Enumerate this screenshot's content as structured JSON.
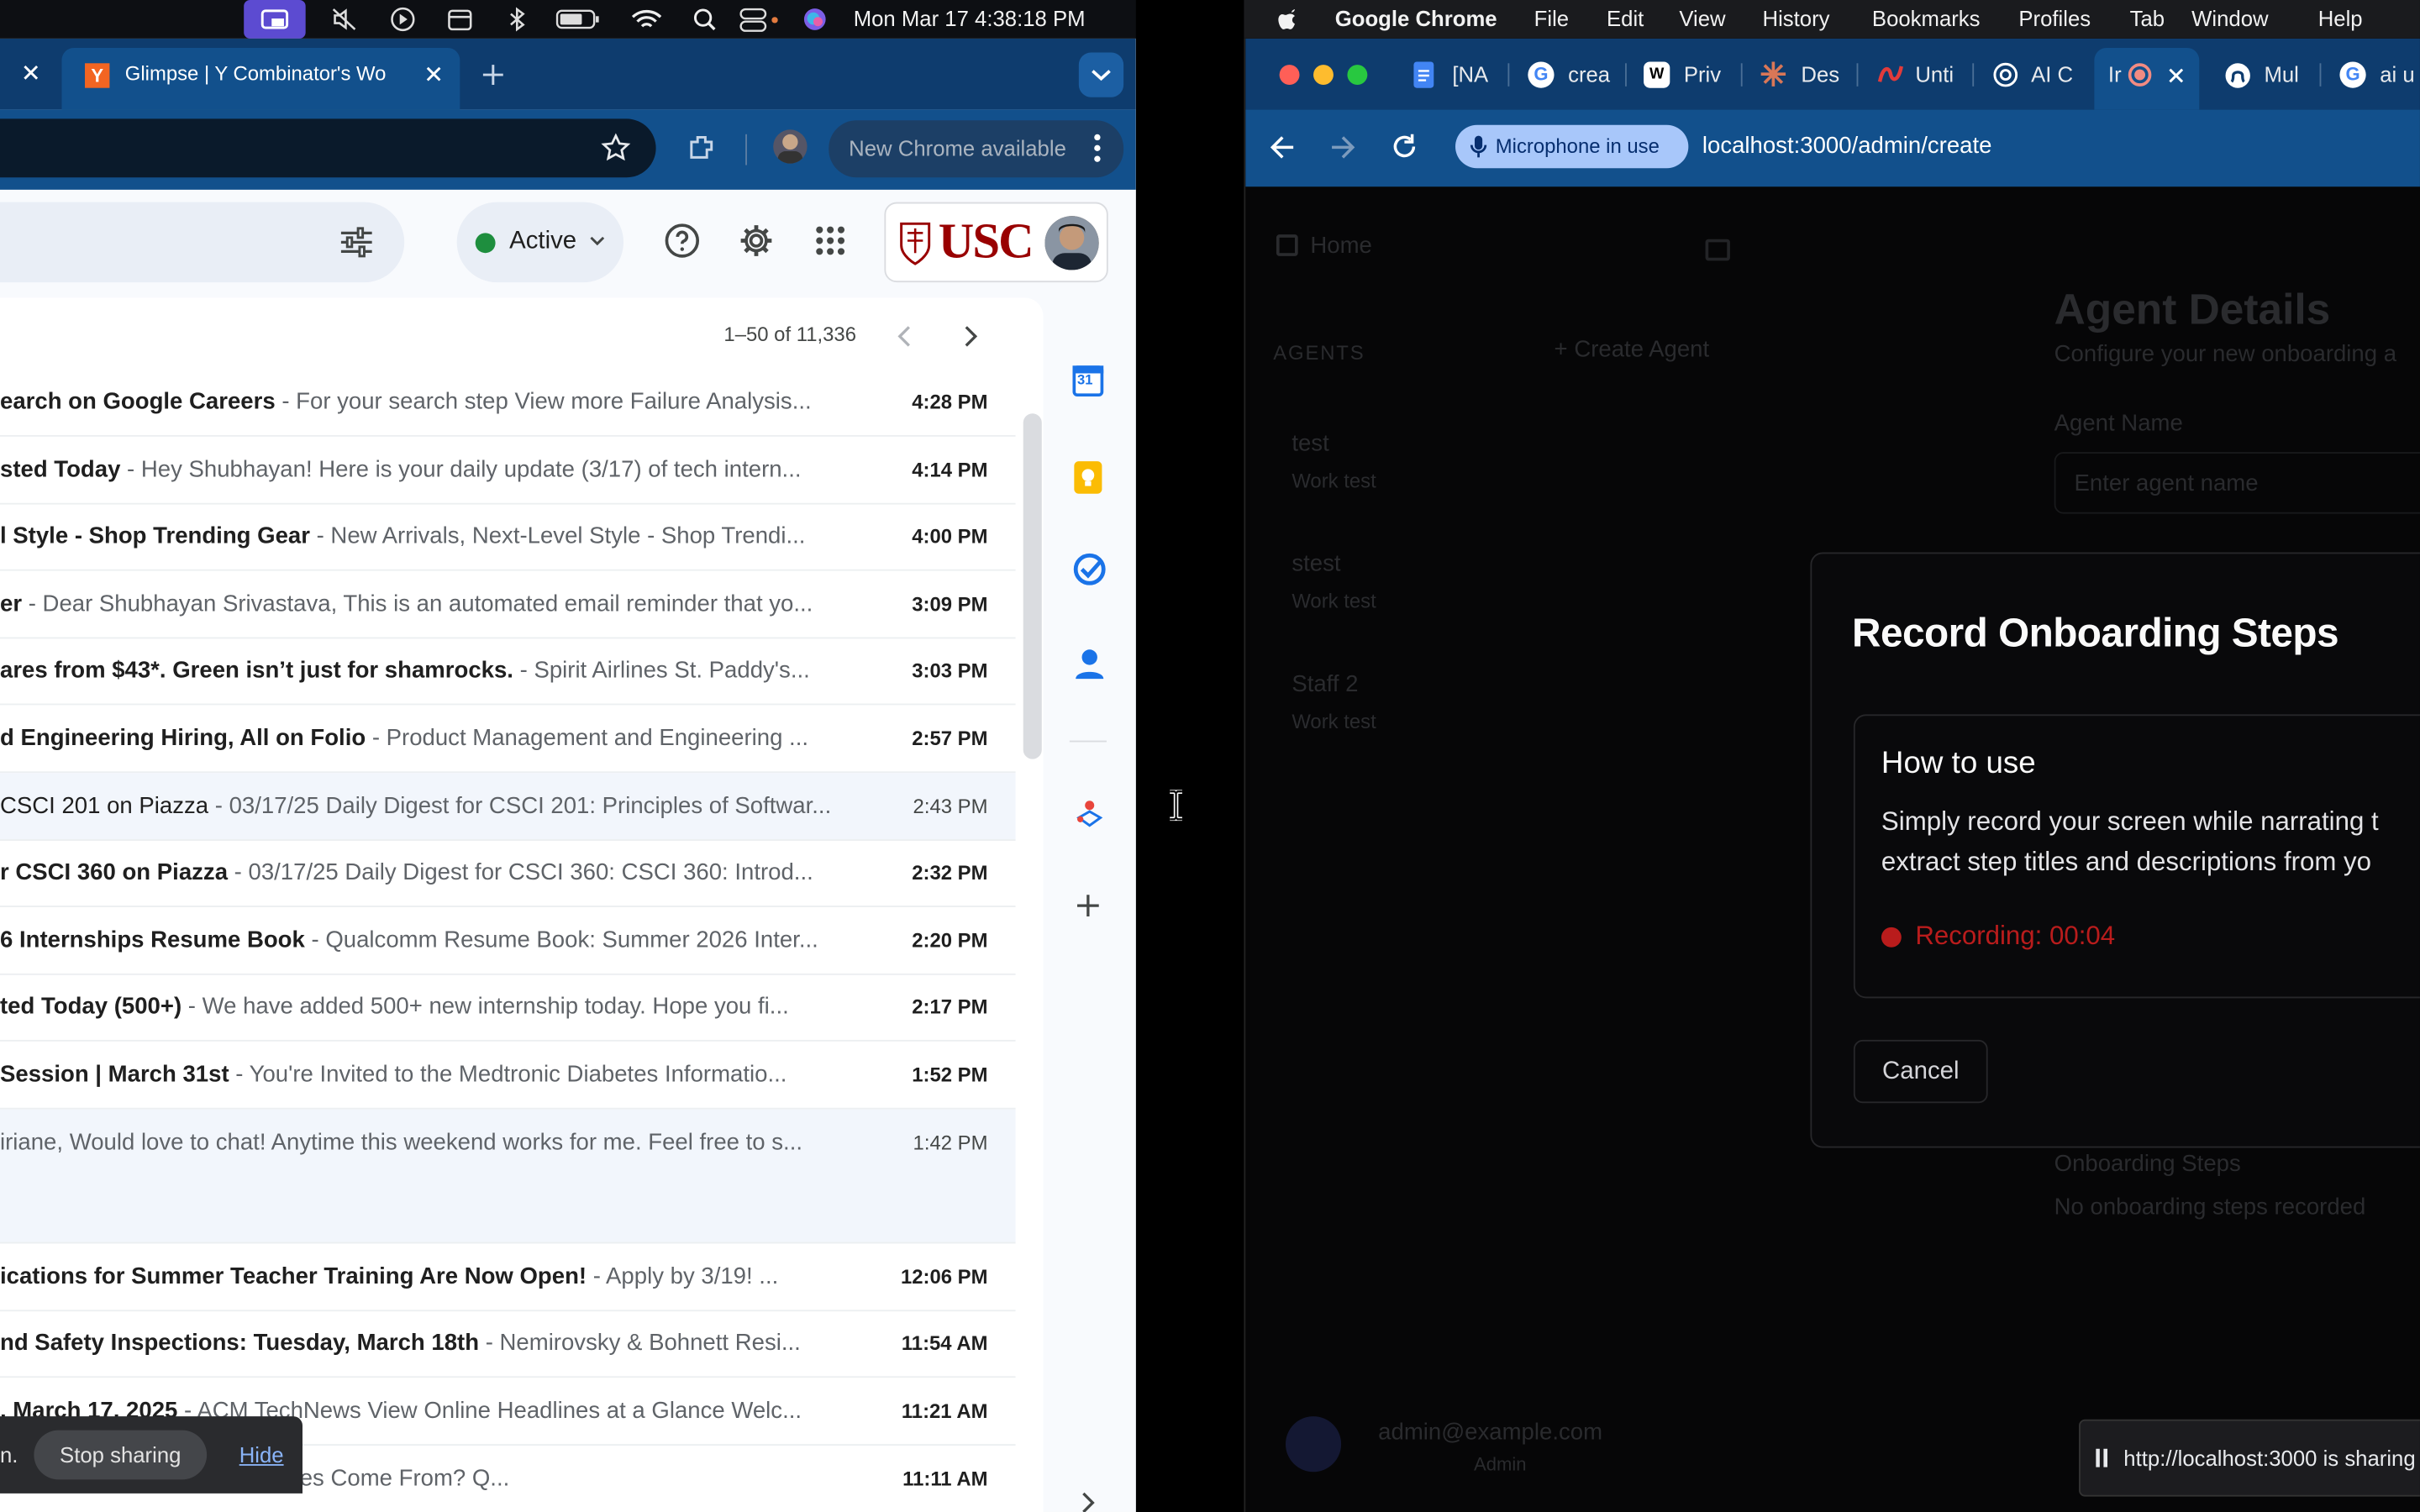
{
  "menubar": {
    "datetime": "Mon Mar 17  4:38:18 PM",
    "app_name": "Google Chrome",
    "menus": [
      "File",
      "Edit",
      "View",
      "History",
      "Bookmarks",
      "Profiles",
      "Tab",
      "Window",
      "Help"
    ]
  },
  "left_window": {
    "tabs": [
      {
        "label": "Glimpse | Y Combinator's Wo",
        "favicon": "Y"
      }
    ],
    "update_button": "New Chrome available",
    "gmail": {
      "status": "Active",
      "org_logo": "USC",
      "pagination": "1–50 of 11,336",
      "calendar_day": "31",
      "emails": [
        {
          "subject": "earch on Google Careers",
          "snippet": " - For your search step View more Failure Analysis...",
          "time": "4:28 PM",
          "unread": true
        },
        {
          "subject": "sted Today",
          "snippet": " - Hey Shubhayan! Here is your daily update (3/17) of tech intern...",
          "time": "4:14 PM",
          "unread": true
        },
        {
          "subject": "l Style - Shop Trending Gear",
          "snippet": " - New Arrivals, Next-Level Style - Shop Trendi...",
          "time": "4:00 PM",
          "unread": true
        },
        {
          "subject": "er",
          "snippet": " - Dear Shubhayan Srivastava, This is an automated email reminder that yo...",
          "time": "3:09 PM",
          "unread": true
        },
        {
          "subject": "ares from $43*. Green isn’t just for shamrocks.",
          "snippet": " - Spirit Airlines St. Paddy's...",
          "time": "3:03 PM",
          "unread": true
        },
        {
          "subject": "d Engineering Hiring, All on Folio",
          "snippet": " - Product Management and Engineering ...",
          "time": "2:57 PM",
          "unread": true
        },
        {
          "subject": "CSCI 201 on Piazza",
          "snippet": " - 03/17/25 Daily Digest for CSCI 201: Principles of Softwar...",
          "time": "2:43 PM",
          "unread": false
        },
        {
          "subject": "r CSCI 360 on Piazza",
          "snippet": " - 03/17/25 Daily Digest for CSCI 360: CSCI 360: Introd...",
          "time": "2:32 PM",
          "unread": true
        },
        {
          "subject": "6 Internships Resume Book",
          "snippet": " - Qualcomm Resume Book: Summer 2026 Inter...",
          "time": "2:20 PM",
          "unread": true
        },
        {
          "subject": "ted Today (500+)",
          "snippet": " - We have added 500+ new internship today. Hope you fi...",
          "time": "2:17 PM",
          "unread": true
        },
        {
          "subject": " Session | March 31st",
          "snippet": " - You're Invited to the Medtronic Diabetes Informatio...",
          "time": "1:52 PM",
          "unread": true
        },
        {
          "subject": "",
          "snippet": "iriane, Would love to chat! Anytime this weekend works for me. Feel free to s...",
          "time": "1:42 PM",
          "unread": false
        },
        {
          "subject": "ications for Summer Teacher Training Are Now Open!",
          "snippet": " - Apply by 3/19!    ...",
          "time": "12:06 PM",
          "unread": true
        },
        {
          "subject": "nd Safety Inspections: Tuesday, March 18th",
          "snippet": " - Nemirovsky & Bohnett Resi...",
          "time": "11:54 AM",
          "unread": true
        },
        {
          "subject": ", March 17, 2025",
          "snippet": " - ACM TechNews View Online Headlines at a Glance Welc...",
          "time": "11:21 AM",
          "unread": true
        },
        {
          "subject": "",
          "snippet": "JO - Where Do BIG Companies Come From? Q...",
          "time": "11:11 AM",
          "unread": true
        }
      ]
    },
    "share_bar": {
      "prefix": "n.",
      "stop": "Stop sharing",
      "hide": "Hide"
    }
  },
  "right_window": {
    "tabs": [
      "[NA",
      "crea",
      "Priv",
      "Des",
      "Unti",
      "AI C",
      "Ir",
      "Mul",
      "ai u"
    ],
    "mic_indicator": "Microphone in use",
    "url": "localhost:3000/admin/create",
    "background": {
      "nav_home": "Home",
      "section": "AGENTS",
      "create": "Create Agent",
      "items": [
        {
          "title": "test",
          "sub": "Work test"
        },
        {
          "title": "stest",
          "sub": "Work test"
        },
        {
          "title": "Staff 2",
          "sub": "Work test"
        }
      ],
      "heading": "Agent Details",
      "subheading": "Configure your new onboarding a",
      "field_label": "Agent Name",
      "field_placeholder": "Enter agent name",
      "steps_label": "Onboarding Steps",
      "steps_empty": "No onboarding steps recorded",
      "user_email": "admin@example.com",
      "user_role": "Admin"
    },
    "modal": {
      "title": "Record Onboarding Steps",
      "howto_title": "How to use",
      "howto_line1": "Simply record your screen while narrating t",
      "howto_line2": "extract step titles and descriptions from yo",
      "recording": "Recording: 00:04",
      "cancel": "Cancel"
    },
    "share_notice": "http://localhost:3000 is sharing"
  }
}
